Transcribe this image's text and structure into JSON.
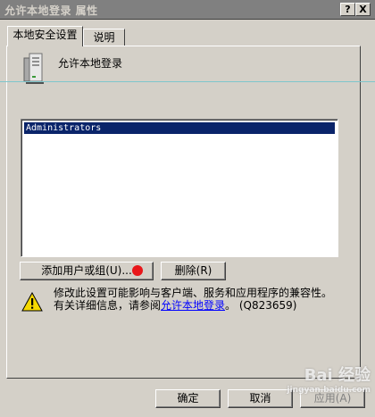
{
  "window": {
    "title": "允许本地登录 属性",
    "help_button": "?",
    "close_button": "X"
  },
  "tabs": [
    {
      "label": "本地安全设置",
      "active": true
    },
    {
      "label": "说明",
      "active": false
    }
  ],
  "policy": {
    "name": "允许本地登录",
    "icon": "server-icon"
  },
  "members": [
    "Administrators"
  ],
  "buttons": {
    "add": "添加用户或组(U)...",
    "remove": "删除(R)",
    "ok": "确定",
    "cancel": "取消",
    "apply": "应用(A)"
  },
  "warning": {
    "icon": "warning-icon",
    "line1": "修改此设置可能影响与客户端、服务和应用程序的兼容性。",
    "line2_prefix": "有关详细信息，请参阅",
    "link": "允许本地登录",
    "line2_suffix": "。 (Q823659)"
  },
  "watermark": {
    "text1": "Bai 经验",
    "text2": "jingyan.baidu.com"
  },
  "colors": {
    "dialog_bg": "#d4d0c8",
    "title_bar": "#808080",
    "selection": "#0a246a",
    "marker": "#e8161a",
    "link": "#0000ff"
  }
}
